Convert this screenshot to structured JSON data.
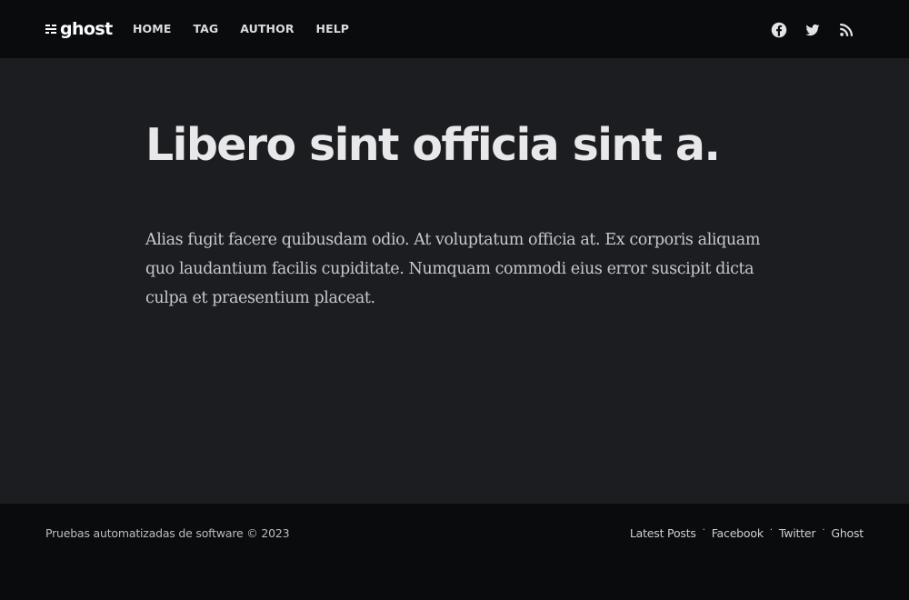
{
  "header": {
    "logo_text": "ghost",
    "nav": [
      {
        "label": "HOME"
      },
      {
        "label": "TAG"
      },
      {
        "label": "AUTHOR"
      },
      {
        "label": "HELP"
      }
    ],
    "social_icons": [
      "facebook-icon",
      "twitter-icon",
      "rss-icon"
    ]
  },
  "post": {
    "title": "Libero sint officia sint a.",
    "body": "Alias fugit facere quibusdam odio. At voluptatum officia at. Ex corporis aliquam quo laudantium facilis cupiditate. Numquam commodi eius error suscipit dicta culpa et praesentium placeat."
  },
  "footer": {
    "copyright": "Pruebas automatizadas de software © 2023",
    "links": [
      {
        "label": "Latest Posts"
      },
      {
        "label": "Facebook"
      },
      {
        "label": "Twitter"
      },
      {
        "label": "Ghost"
      }
    ],
    "separator": "·"
  },
  "colors": {
    "header_bg": "#0a0b0c",
    "main_bg": "#1c1d21",
    "title": "#e8e8ea",
    "body_text": "#c8c8cc"
  }
}
